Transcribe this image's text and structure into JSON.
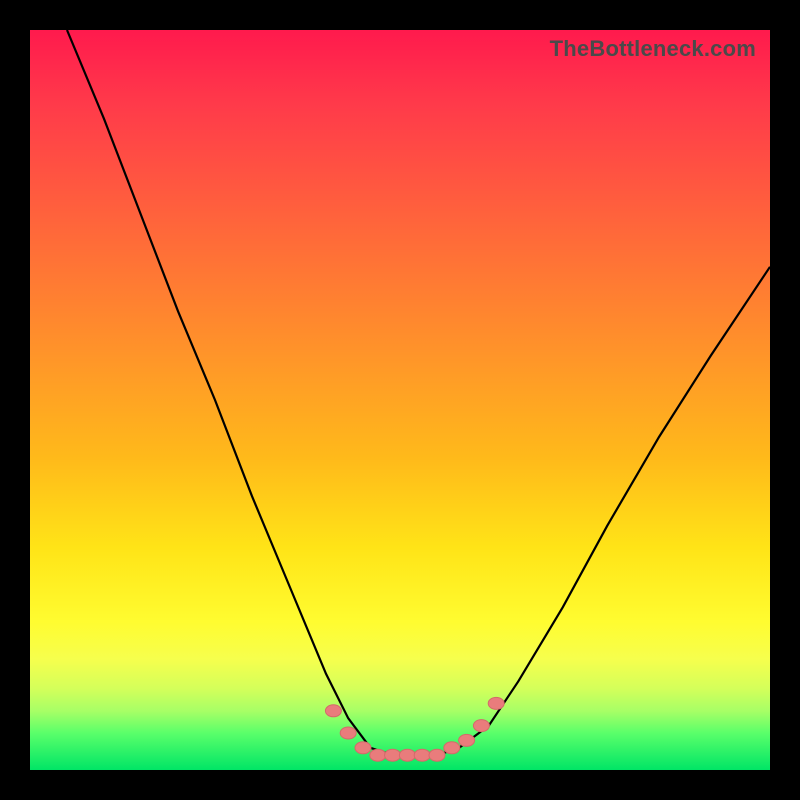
{
  "watermark": "TheBottleneck.com",
  "colors": {
    "frame": "#000000",
    "curve": "#000000",
    "marker_fill": "#e97c7c",
    "marker_stroke": "#d46a6a",
    "gradient_stops": [
      "#ff1a4d",
      "#ff5a3f",
      "#ff9a27",
      "#ffe417",
      "#f6ff4d",
      "#5aff6a",
      "#00e566"
    ]
  },
  "chart_data": {
    "type": "line",
    "title": "",
    "xlabel": "",
    "ylabel": "",
    "xlim": [
      0,
      100
    ],
    "ylim": [
      0,
      100
    ],
    "grid": false,
    "legend": false,
    "note": "Axes have no tick labels in the source image; x and y are normalized 0-100. Color gradient encodes y from 100 (red, top) to 0 (green, bottom). Curve is a V-shaped bottleneck. Markers cluster near the minimum.",
    "series": [
      {
        "name": "bottleneck-curve",
        "x": [
          5,
          10,
          15,
          20,
          25,
          30,
          35,
          40,
          43,
          46,
          49,
          52,
          55,
          58,
          62,
          66,
          72,
          78,
          85,
          92,
          100
        ],
        "y": [
          100,
          88,
          75,
          62,
          50,
          37,
          25,
          13,
          7,
          3,
          2,
          2,
          2,
          3,
          6,
          12,
          22,
          33,
          45,
          56,
          68
        ]
      }
    ],
    "markers": {
      "name": "highlight-points",
      "x": [
        41,
        43,
        45,
        47,
        49,
        51,
        53,
        55,
        57,
        59,
        61,
        63
      ],
      "y": [
        8,
        5,
        3,
        2,
        2,
        2,
        2,
        2,
        3,
        4,
        6,
        9
      ]
    }
  }
}
